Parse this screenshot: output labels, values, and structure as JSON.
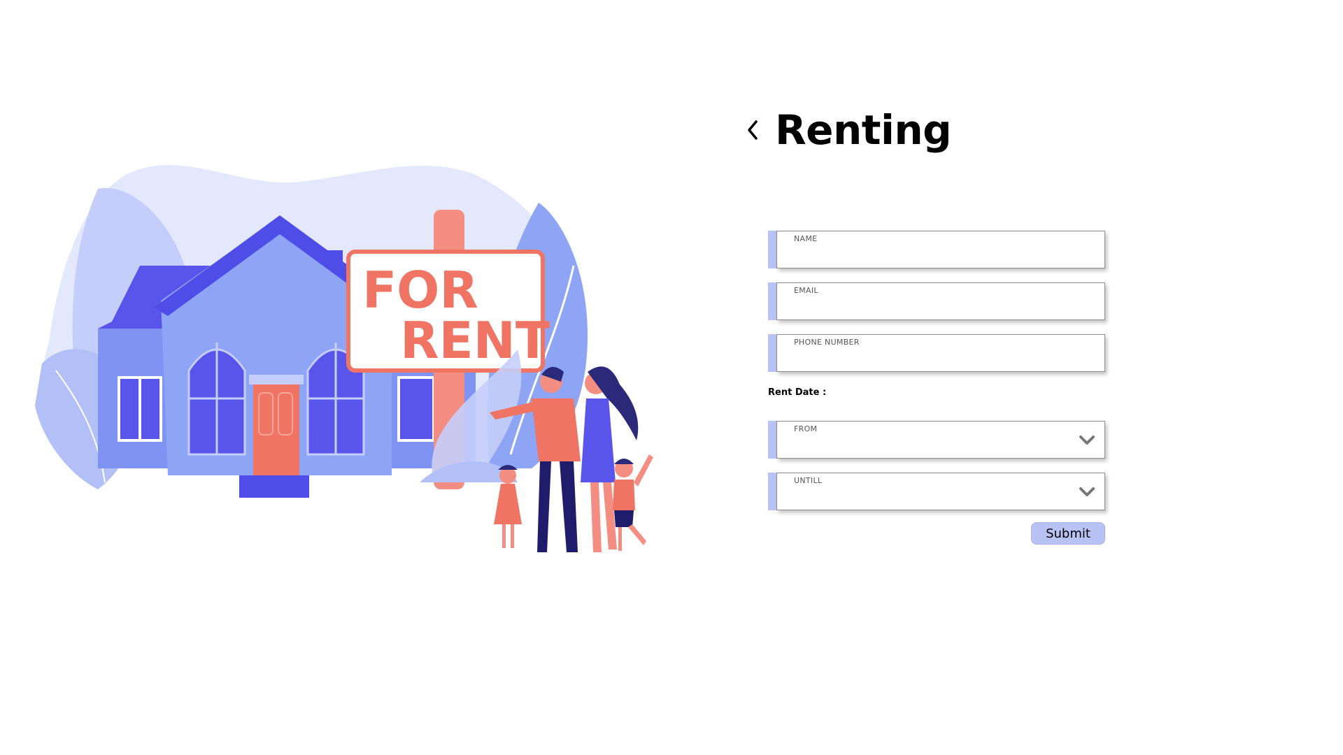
{
  "header": {
    "title": "Renting",
    "back_icon": "chevron-left-icon"
  },
  "illustration": {
    "sign_line1": "FOR",
    "sign_line2": "RENT"
  },
  "form": {
    "name_label": "NAME",
    "email_label": "EMAIL",
    "phone_label": "PHONE NUMBER",
    "rent_date_label": "Rent Date :",
    "from_label": "FROM",
    "until_label": "UNTILL",
    "dropdown_icon": "chevron-down-icon",
    "submit_label": "Submit"
  },
  "colors": {
    "accent": "#b9c2f4",
    "sign_text": "#f07463",
    "house_primary": "#8ea4f5",
    "house_dark": "#4f4de8"
  }
}
